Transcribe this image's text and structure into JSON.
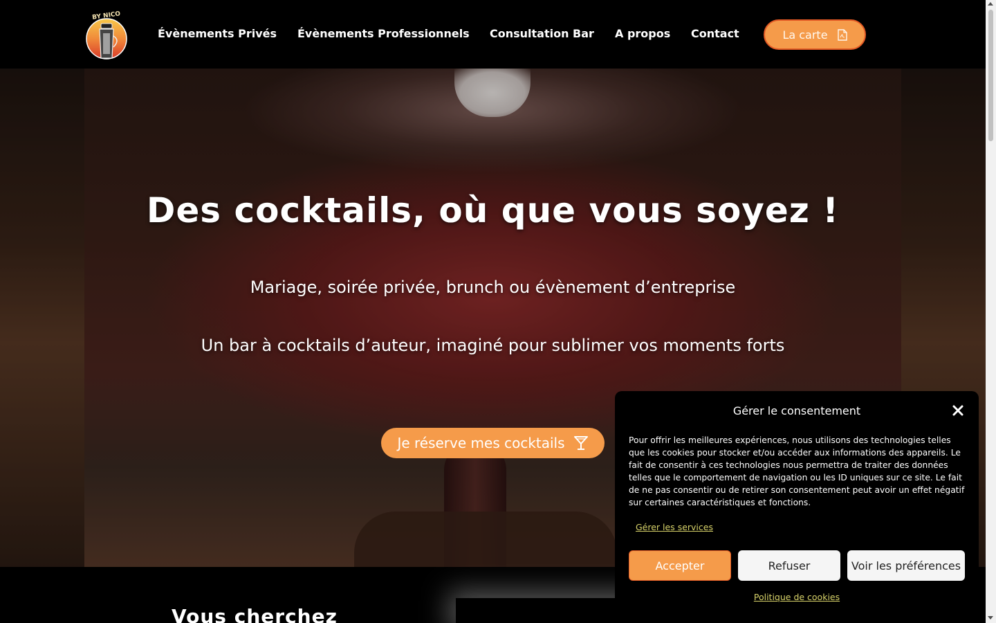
{
  "header": {
    "logo_text": "BY NICO",
    "nav": [
      {
        "label": "Évènements Privés"
      },
      {
        "label": "Évènements Professionnels"
      },
      {
        "label": "Consultation Bar"
      },
      {
        "label": "A propos"
      },
      {
        "label": "Contact"
      }
    ],
    "carte_button": {
      "label": "La carte",
      "icon": "pdf-file-icon"
    }
  },
  "hero": {
    "title": "Des cocktails, où que vous soyez !",
    "subtitle1": "Mariage, soirée privée, brunch ou évènement d’entreprise",
    "subtitle2": "Un bar à cocktails d’auteur, imaginé pour sublimer vos moments forts",
    "cta": {
      "label": "Je réserve mes cocktails",
      "icon": "cocktail-glass-icon"
    }
  },
  "below": {
    "heading_partial": "Vous cherchez"
  },
  "consent": {
    "title": "Gérer le consentement",
    "text": "Pour offrir les meilleures expériences, nous utilisons des technologies telles que les cookies pour stocker et/ou accéder aux informations des appareils. Le fait de consentir à ces technologies nous permettra de traiter des données telles que le comportement de navigation ou les ID uniques sur ce site. Le fait de ne pas consentir ou de retirer son consentement peut avoir un effet négatif sur certaines caractéristiques et fonctions.",
    "manage_services": "Gérer les services",
    "accept": "Accepter",
    "refuse": "Refuser",
    "preferences": "Voir les préférences",
    "policy": "Politique de cookies"
  },
  "colors": {
    "accent": "#f59b4a",
    "accent_border": "#e35a25",
    "link_yellow": "#d8d36a",
    "background": "#000000"
  }
}
